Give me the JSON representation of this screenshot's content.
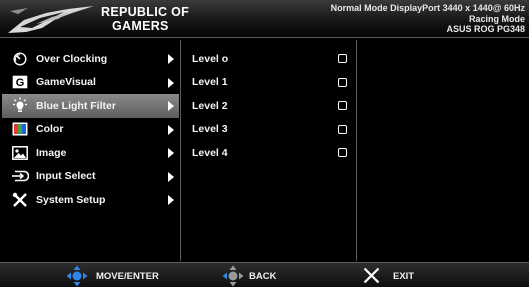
{
  "header": {
    "brand_line1": "REPUBLIC OF",
    "brand_line2": "GAMERS",
    "status_line1": "Normal Mode DisplayPort 3440 x 1440@ 60Hz",
    "status_line2": "Racing Mode",
    "status_line3": "ASUS ROG PG348"
  },
  "main_menu": {
    "items": [
      {
        "label": "Over Clocking",
        "icon": "overclock-icon"
      },
      {
        "label": "GameVisual",
        "icon": "gamevisual-icon"
      },
      {
        "label": "Blue Light Filter",
        "icon": "blue-light-icon",
        "selected": true
      },
      {
        "label": "Color",
        "icon": "color-icon"
      },
      {
        "label": "Image",
        "icon": "image-icon"
      },
      {
        "label": "Input Select",
        "icon": "input-select-icon"
      },
      {
        "label": "System Setup",
        "icon": "system-setup-icon"
      }
    ]
  },
  "sub_menu": {
    "items": [
      {
        "label": "Level o"
      },
      {
        "label": "Level 1"
      },
      {
        "label": "Level 2"
      },
      {
        "label": "Level 3"
      },
      {
        "label": "Level 4"
      }
    ]
  },
  "footer": {
    "move_label": "MOVE/ENTER",
    "back_label": "BACK",
    "exit_label": "EXIT"
  },
  "colors": {
    "background": "#000000",
    "selected_highlight": "#7a7a7a",
    "joystick_blue": "#2f86e6"
  }
}
